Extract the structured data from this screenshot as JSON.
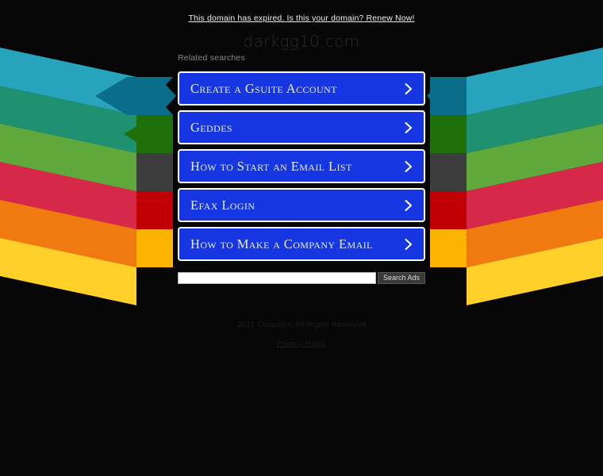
{
  "banner": {
    "text": "This domain has expired. Is this your domain? Renew Now!"
  },
  "domain": {
    "title": "darkgg10.com"
  },
  "related": {
    "label": "Related searches"
  },
  "ads": [
    {
      "label": "Create a Gsuite Account",
      "icon": "chevron-right-icon"
    },
    {
      "label": "Geddes",
      "icon": "chevron-right-icon"
    },
    {
      "label": "How to Start an Email List",
      "icon": "chevron-right-icon"
    },
    {
      "label": "Efax Login",
      "icon": "chevron-right-icon"
    },
    {
      "label": "How to Make a Company Email",
      "icon": "chevron-right-icon"
    }
  ],
  "search": {
    "value": "",
    "placeholder": "",
    "button_label": "Search Ads"
  },
  "footer": {
    "copyright": "2021 Copyright. All Rights Reserved",
    "privacy_label": "Privacy Policy"
  },
  "colors": {
    "background": "#070707",
    "ad_blue": "#1536e0",
    "ad_border": "#ffffff",
    "ad_text": "#e8ecff",
    "banner_text": "#efefef",
    "domain_text": "#2a2a2a",
    "footer_text": "#1d1d1d",
    "band_cyan_bright": "#27a3bd",
    "band_cyan_dark": "#0a6e8a",
    "band_green_bright": "#5fa83c",
    "band_green_dark": "#1f700b",
    "band_gray_bright": "#7b7b7b",
    "band_gray_dark": "#3d3d3d",
    "band_red_bright": "#d6294a",
    "band_red_dark": "#c10006",
    "band_orange_bright": "#f07a10",
    "band_yellow_bright": "#ffd029",
    "band_yellow_dark": "#fcb400"
  }
}
